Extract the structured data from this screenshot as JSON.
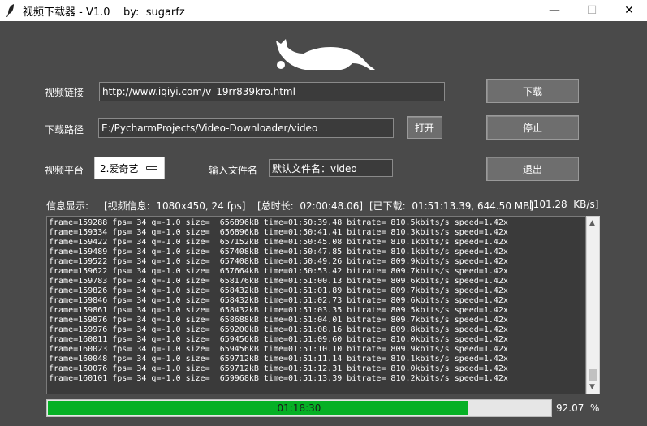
{
  "window": {
    "title": "视频下载器 - V1.0    by:  sugarfz",
    "minimize_glyph": "—",
    "maximize_glyph": "☐",
    "close_glyph": "✕",
    "app_icon": "feather-icon"
  },
  "logo": {
    "icon": "cat-icon"
  },
  "form": {
    "url_label": "视频链接",
    "url_value": "http://www.iqiyi.com/v_19rr839kro.html",
    "path_label": "下载路径",
    "path_value": "E:/PycharmProjects/Video-Downloader/video",
    "open_button": "打开",
    "platform_label": "视频平台",
    "platform_selected": "2.爱奇艺",
    "filename_label": "输入文件名",
    "filename_value": "默认文件名：video"
  },
  "buttons": {
    "download": "下载",
    "stop": "停止",
    "exit": "退出"
  },
  "info": {
    "label": "信息显示:",
    "video_info": "[视频信息:  1080x450, 24 fps]",
    "duration": "[总时长:  02:00:48.06]",
    "downloaded": "[已下载:  01:51:13.39, 644.50 MB]",
    "speed": "[101.28  KB/s]"
  },
  "log_lines": [
    "frame=159288 fps= 34 q=-1.0 size=  656896kB time=01:50:39.48 bitrate= 810.5kbits/s speed=1.42x",
    "frame=159334 fps= 34 q=-1.0 size=  656896kB time=01:50:41.41 bitrate= 810.3kbits/s speed=1.42x",
    "frame=159422 fps= 34 q=-1.0 size=  657152kB time=01:50:45.08 bitrate= 810.1kbits/s speed=1.42x",
    "frame=159489 fps= 34 q=-1.0 size=  657408kB time=01:50:47.85 bitrate= 810.1kbits/s speed=1.42x",
    "frame=159522 fps= 34 q=-1.0 size=  657408kB time=01:50:49.26 bitrate= 809.9kbits/s speed=1.42x",
    "frame=159622 fps= 34 q=-1.0 size=  657664kB time=01:50:53.42 bitrate= 809.7kbits/s speed=1.42x",
    "frame=159783 fps= 34 q=-1.0 size=  658176kB time=01:51:00.13 bitrate= 809.6kbits/s speed=1.42x",
    "frame=159826 fps= 34 q=-1.0 size=  658432kB time=01:51:01.89 bitrate= 809.7kbits/s speed=1.42x",
    "frame=159846 fps= 34 q=-1.0 size=  658432kB time=01:51:02.73 bitrate= 809.6kbits/s speed=1.42x",
    "frame=159861 fps= 34 q=-1.0 size=  658432kB time=01:51:03.35 bitrate= 809.5kbits/s speed=1.42x",
    "frame=159876 fps= 34 q=-1.0 size=  658688kB time=01:51:04.01 bitrate= 809.7kbits/s speed=1.42x",
    "frame=159976 fps= 34 q=-1.0 size=  659200kB time=01:51:08.16 bitrate= 809.8kbits/s speed=1.42x",
    "frame=160011 fps= 34 q=-1.0 size=  659456kB time=01:51:09.60 bitrate= 810.0kbits/s speed=1.42x",
    "frame=160023 fps= 34 q=-1.0 size=  659456kB time=01:51:10.10 bitrate= 809.9kbits/s speed=1.42x",
    "frame=160048 fps= 34 q=-1.0 size=  659712kB time=01:51:11.14 bitrate= 810.1kbits/s speed=1.42x",
    "frame=160076 fps= 34 q=-1.0 size=  659712kB time=01:51:12.31 bitrate= 810.0kbits/s speed=1.42x",
    "frame=160101 fps= 34 q=-1.0 size=  659968kB time=01:51:13.39 bitrate= 810.2kbits/s speed=1.42x"
  ],
  "progress": {
    "time_text": "01:18:30",
    "fraction": 0.9207,
    "percent_text": "92.07  %",
    "fill_color": "#06b025"
  }
}
